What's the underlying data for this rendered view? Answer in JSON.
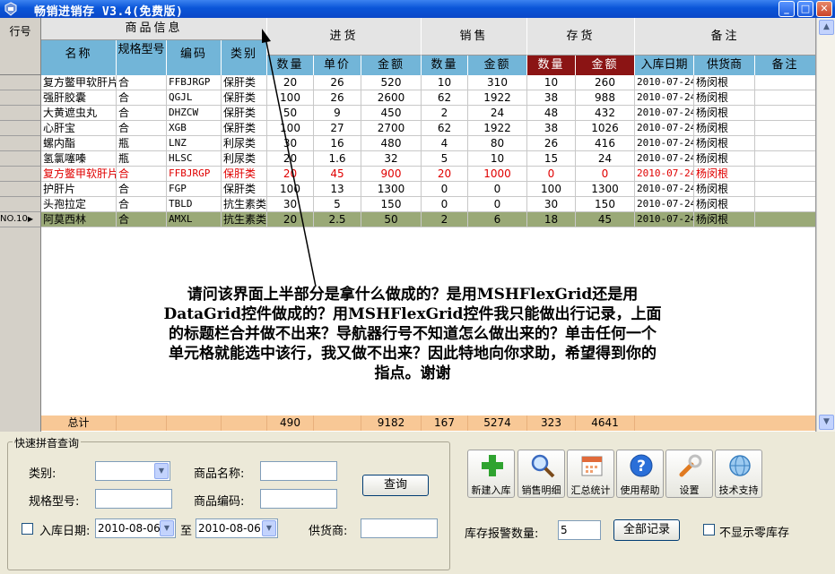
{
  "window": {
    "title": "畅销进销存 V3.4(免费版)"
  },
  "grid": {
    "rowhdr_title": "行号",
    "groups": [
      "商品信息",
      "进货",
      "销售",
      "存货",
      "备注"
    ],
    "columns": [
      "名称",
      "规格型号",
      "编码",
      "类别",
      "数量",
      "单价",
      "金额",
      "数量",
      "金额",
      "数量",
      "金额",
      "入库日期",
      "供货商",
      "备注"
    ],
    "rows": [
      [
        "复方鳖甲软肝片",
        "合",
        "FFBJRGP",
        "保肝类",
        "20",
        "26",
        "520",
        "10",
        "310",
        "10",
        "260",
        "2010-07-24",
        "杨闵根",
        ""
      ],
      [
        "强肝胶囊",
        "合",
        "QGJL",
        "保肝类",
        "100",
        "26",
        "2600",
        "62",
        "1922",
        "38",
        "988",
        "2010-07-24",
        "杨闵根",
        ""
      ],
      [
        "大黄遮虫丸",
        "合",
        "DHZCW",
        "保肝类",
        "50",
        "9",
        "450",
        "2",
        "24",
        "48",
        "432",
        "2010-07-24",
        "杨闵根",
        ""
      ],
      [
        "心肝宝",
        "合",
        "XGB",
        "保肝类",
        "100",
        "27",
        "2700",
        "62",
        "1922",
        "38",
        "1026",
        "2010-07-24",
        "杨闵根",
        ""
      ],
      [
        "螺内酯",
        "瓶",
        "LNZ",
        "利尿类",
        "30",
        "16",
        "480",
        "4",
        "80",
        "26",
        "416",
        "2010-07-24",
        "杨闵根",
        ""
      ],
      [
        "氢氯噻嗪",
        "瓶",
        "HLSC",
        "利尿类",
        "20",
        "1.6",
        "32",
        "5",
        "10",
        "15",
        "24",
        "2010-07-24",
        "杨闵根",
        ""
      ],
      [
        "复方鳖甲软肝片",
        "合",
        "FFBJRGP",
        "保肝类",
        "20",
        "45",
        "900",
        "20",
        "1000",
        "0",
        "0",
        "2010-07-24",
        "杨闵根",
        ""
      ],
      [
        "护肝片",
        "合",
        "FGP",
        "保肝类",
        "100",
        "13",
        "1300",
        "0",
        "0",
        "100",
        "1300",
        "2010-07-24",
        "杨闵根",
        ""
      ],
      [
        "头孢拉定",
        "合",
        "TBLD",
        "抗生素类",
        "30",
        "5",
        "150",
        "0",
        "0",
        "30",
        "150",
        "2010-07-24",
        "杨闵根",
        ""
      ],
      [
        "阿莫西林",
        "合",
        "AMXL",
        "抗生素类",
        "20",
        "2.5",
        "50",
        "2",
        "6",
        "18",
        "45",
        "2010-07-24",
        "杨闵根",
        ""
      ]
    ],
    "current_row_label": "NO.10",
    "total": {
      "label": "总计",
      "in_qty": "490",
      "in_amt": "9182",
      "sale_qty": "167",
      "sale_amt": "5274",
      "stock_qty": "323",
      "stock_amt": "4641"
    }
  },
  "note": "请问该界面上半部分是拿什么做成的？是用MSHFlexGrid还是用DataGrid控件做成的？用MSHFlexGrid控件我只能做出行记录，上面的标题栏合并做不出来？导航器行号不知道怎么做出来的？单击任何一个单元格就能选中该行，我又做不出来？因此特地向你求助，希望得到你的指点。谢谢",
  "search": {
    "group_title": "快速拼音查询",
    "category_label": "类别:",
    "name_label": "商品名称:",
    "spec_label": "规格型号:",
    "code_label": "商品编码:",
    "date_label": "入库日期:",
    "date_from": "2010-08-06",
    "to_label": "至",
    "date_to": "2010-08-06",
    "supplier_label": "供货商:",
    "query_button": "查询"
  },
  "toolbar": {
    "buttons": [
      "新建入库",
      "销售明细",
      "汇总统计",
      "使用帮助",
      "设置",
      "技术支持"
    ],
    "alert_label": "库存报警数量:",
    "alert_value": "5",
    "all_records_button": "全部记录",
    "hide_zero_label": "不显示零库存"
  },
  "colors": {
    "header_blue": "#72b5d8",
    "header_dark_red": "#8b1414",
    "selected_row": "#9aa977",
    "total_row": "#f8c896",
    "red_text": "#e00000"
  }
}
